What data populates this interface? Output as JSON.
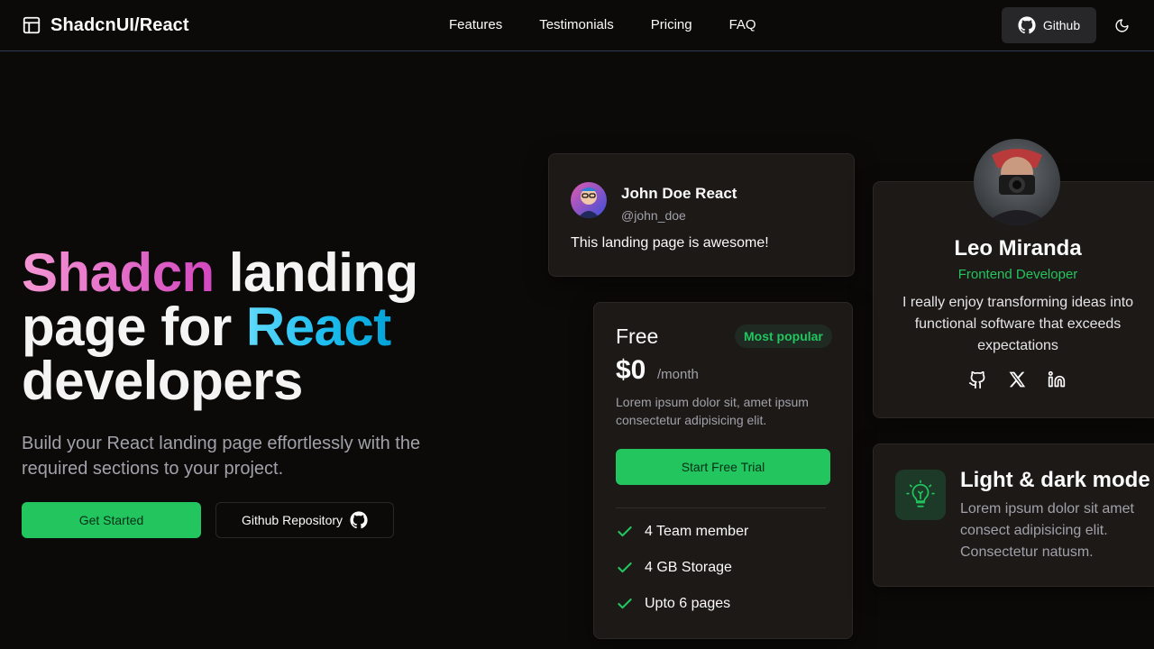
{
  "nav": {
    "brand": "ShadcnUI/React",
    "links": [
      "Features",
      "Testimonials",
      "Pricing",
      "FAQ"
    ],
    "github_label": "Github"
  },
  "hero": {
    "title_part1": "Shadcn",
    "title_part2": " landing page for ",
    "title_part3": "React",
    "title_part4": " developers",
    "subtitle": "Build your React landing page effortlessly with the required sections to your project.",
    "cta_primary": "Get Started",
    "cta_secondary": "Github Repository"
  },
  "testimonial": {
    "name": "John Doe React",
    "handle": "@john_doe",
    "text": "This landing page is awesome!"
  },
  "team": {
    "name": "Leo Miranda",
    "role": "Frontend Developer",
    "bio": "I really enjoy transforming ideas into functional software that exceeds expectations",
    "socials": [
      "github-icon",
      "x-icon",
      "linkedin-icon"
    ]
  },
  "pricing": {
    "title": "Free",
    "badge": "Most popular",
    "price": "$0",
    "period": "/month",
    "description": "Lorem ipsum dolor sit, amet ipsum consectetur adipisicing elit.",
    "cta": "Start Free Trial",
    "features": [
      "4 Team member",
      "4 GB Storage",
      "Upto 6 pages"
    ]
  },
  "feature": {
    "title": "Light & dark mode",
    "description": "Lorem ipsum dolor sit amet consect adipisicing elit. Consectetur natusm."
  },
  "colors": {
    "accent": "#22c55e",
    "background": "#0c0a09",
    "card": "#1c1917"
  }
}
